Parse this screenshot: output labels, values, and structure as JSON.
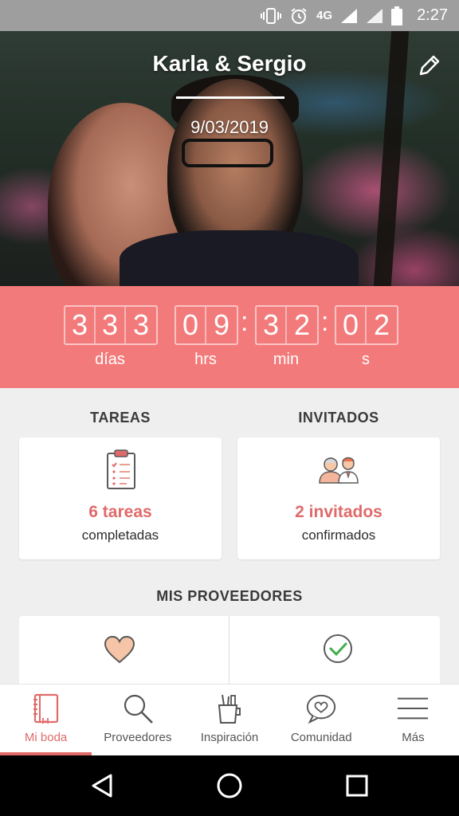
{
  "status_bar": {
    "time": "2:27",
    "network": "4G"
  },
  "header": {
    "couple_names": "Karla & Sergio",
    "wedding_date": "9/03/2019"
  },
  "countdown": {
    "days": [
      "3",
      "3",
      "3"
    ],
    "hours": [
      "0",
      "9"
    ],
    "minutes": [
      "3",
      "2"
    ],
    "seconds": [
      "0",
      "2"
    ],
    "labels": {
      "days": "días",
      "hours": "hrs",
      "minutes": "min",
      "seconds": "s"
    }
  },
  "tasks": {
    "title": "TAREAS",
    "count": "6 tareas",
    "subtitle": "completadas"
  },
  "guests": {
    "title": "INVITADOS",
    "count": "2 invitados",
    "subtitle": "confirmados"
  },
  "providers": {
    "title": "MIS PROVEEDORES"
  },
  "bottom_nav": {
    "items": [
      {
        "label": "Mi boda",
        "icon": "notebook-icon"
      },
      {
        "label": "Proveedores",
        "icon": "search-icon"
      },
      {
        "label": "Inspiración",
        "icon": "cup-icon"
      },
      {
        "label": "Comunidad",
        "icon": "chat-heart-icon"
      },
      {
        "label": "Más",
        "icon": "menu-icon"
      }
    ],
    "active": "Mi boda"
  },
  "colors": {
    "accent": "#f37a7a",
    "accent_text": "#e06a6a",
    "background": "#efefef"
  }
}
